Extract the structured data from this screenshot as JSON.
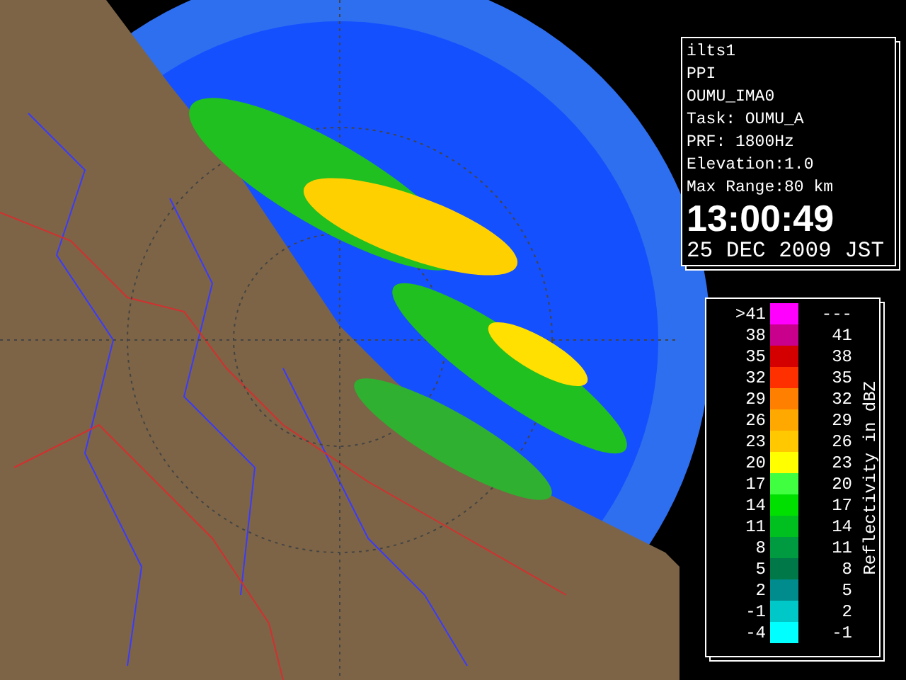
{
  "info_panel": {
    "lines": [
      "ilts1",
      "PPI",
      "OUMU_IMA0",
      "Task: OUMU_A",
      "PRF: 1800Hz",
      "Elevation:1.0",
      "Max Range:80 km"
    ],
    "time": "13:00:49",
    "date": "25 DEC 2009 JST"
  },
  "legend": {
    "title": "Reflectivity in dBZ",
    "rows": [
      {
        "low": ">41",
        "high": "---",
        "color": "#ff00ff"
      },
      {
        "low": "38",
        "high": "41",
        "color": "#c8008c"
      },
      {
        "low": "35",
        "high": "38",
        "color": "#d40000"
      },
      {
        "low": "32",
        "high": "35",
        "color": "#ff3000"
      },
      {
        "low": "29",
        "high": "32",
        "color": "#ff8000"
      },
      {
        "low": "26",
        "high": "29",
        "color": "#ffa800"
      },
      {
        "low": "23",
        "high": "26",
        "color": "#ffc800"
      },
      {
        "low": "20",
        "high": "23",
        "color": "#ffff00"
      },
      {
        "low": "17",
        "high": "20",
        "color": "#40ff40"
      },
      {
        "low": "14",
        "high": "17",
        "color": "#00e000"
      },
      {
        "low": "11",
        "high": "14",
        "color": "#00c020"
      },
      {
        "low": "8",
        "high": "11",
        "color": "#009a40"
      },
      {
        "low": "5",
        "high": "8",
        "color": "#007848"
      },
      {
        "low": "2",
        "high": "5",
        "color": "#008c8c"
      },
      {
        "low": "-1",
        "high": "2",
        "color": "#00c8c8"
      },
      {
        "low": "-4",
        "high": "-1",
        "color": "#00ffff"
      }
    ]
  }
}
